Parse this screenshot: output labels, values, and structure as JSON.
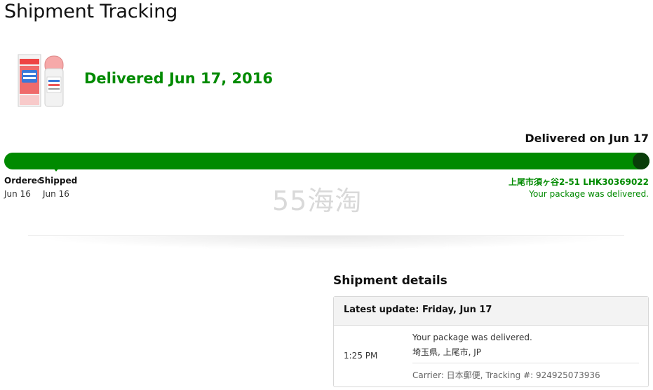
{
  "page": {
    "title": "Shipment Tracking"
  },
  "product": {
    "image_icon": "product-box-and-bottle-icon"
  },
  "status": {
    "headline": "Delivered Jun 17, 2016",
    "delivered_on": "Delivered on Jun 17",
    "progress_percent": 100,
    "accent_color": "#008a00",
    "end_dot_color": "#0a3d0a"
  },
  "milestones": [
    {
      "label": "Ordered",
      "date": "Jun 16"
    },
    {
      "label": "Shipped",
      "date": "Jun 16"
    }
  ],
  "destination": {
    "address": "上尾市須ヶ谷2-51 LHK30369022",
    "message": "Your package was delivered."
  },
  "watermark": {
    "text": "55海淘"
  },
  "shipment_details": {
    "title": "Shipment details",
    "latest_update": "Latest update: Friday, Jun 17",
    "event": {
      "time": "1:25 PM",
      "message": "Your package was delivered.",
      "location": "埼玉県, 上尾市, JP",
      "carrier": "Carrier: 日本郵便, Tracking #: 924925073936"
    }
  }
}
